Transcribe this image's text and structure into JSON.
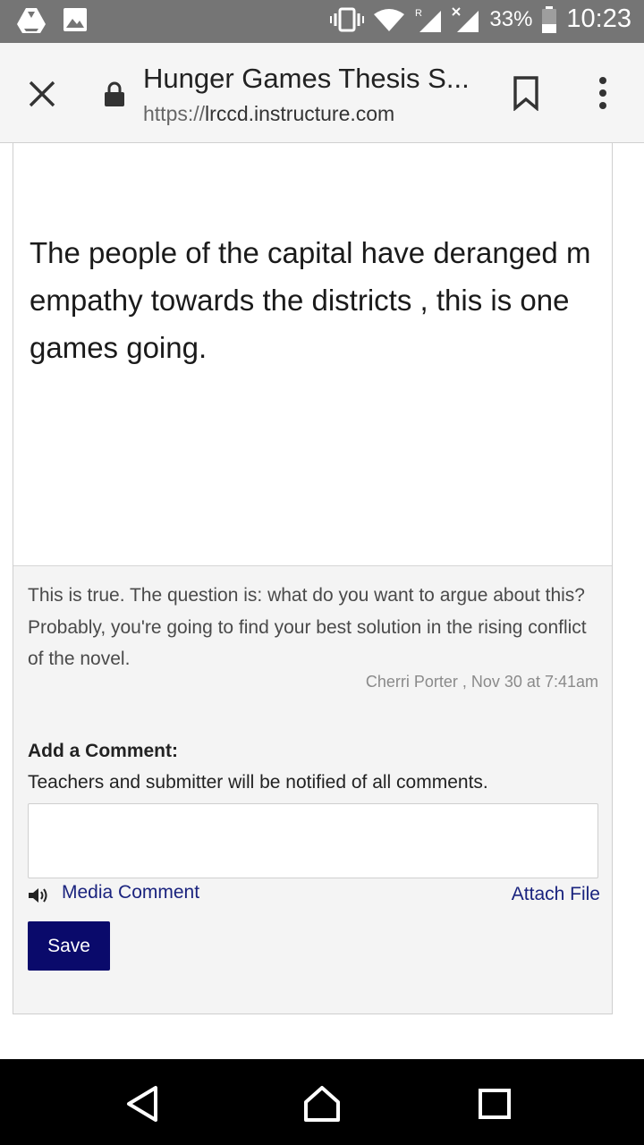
{
  "status_bar": {
    "battery": "33%",
    "time": "10:23",
    "icons": [
      "drive-icon",
      "image-icon",
      "vibrate-icon",
      "wifi-icon",
      "signal-roaming-icon",
      "signal-no-data-icon",
      "battery-icon"
    ]
  },
  "browser": {
    "title": "Hunger Games Thesis S...",
    "url_scheme": "https://",
    "url_host": "lrccd.instructure.com",
    "icons": [
      "close-icon",
      "lock-icon",
      "bookmark-icon",
      "overflow-menu-icon"
    ]
  },
  "essay": {
    "lines": [
      "The people of the capital have deranged m",
      "empathy towards the districts , this is one",
      "games going."
    ]
  },
  "comment": {
    "text": "This is true. The question is: what do you want to argue about this? Probably, you're going to find your best solution in the rising conflict of the novel.",
    "meta": "Cherri Porter , Nov 30 at 7:41am"
  },
  "add_comment": {
    "heading": "Add a Comment:",
    "note": "Teachers and submitter will be notified of all comments.",
    "input_value": "",
    "media_comment_label": "Media Comment",
    "attach_file_label": "Attach File",
    "save_label": "Save"
  },
  "nav_bar": {
    "icons": [
      "back-icon",
      "home-icon",
      "recents-icon"
    ]
  },
  "colors": {
    "status_bar_bg": "#757575",
    "toolbar_bg": "#f5f5f5",
    "link": "#1a237e",
    "save_button_bg": "#0a0a6b",
    "comment_bg": "#f4f4f4"
  }
}
